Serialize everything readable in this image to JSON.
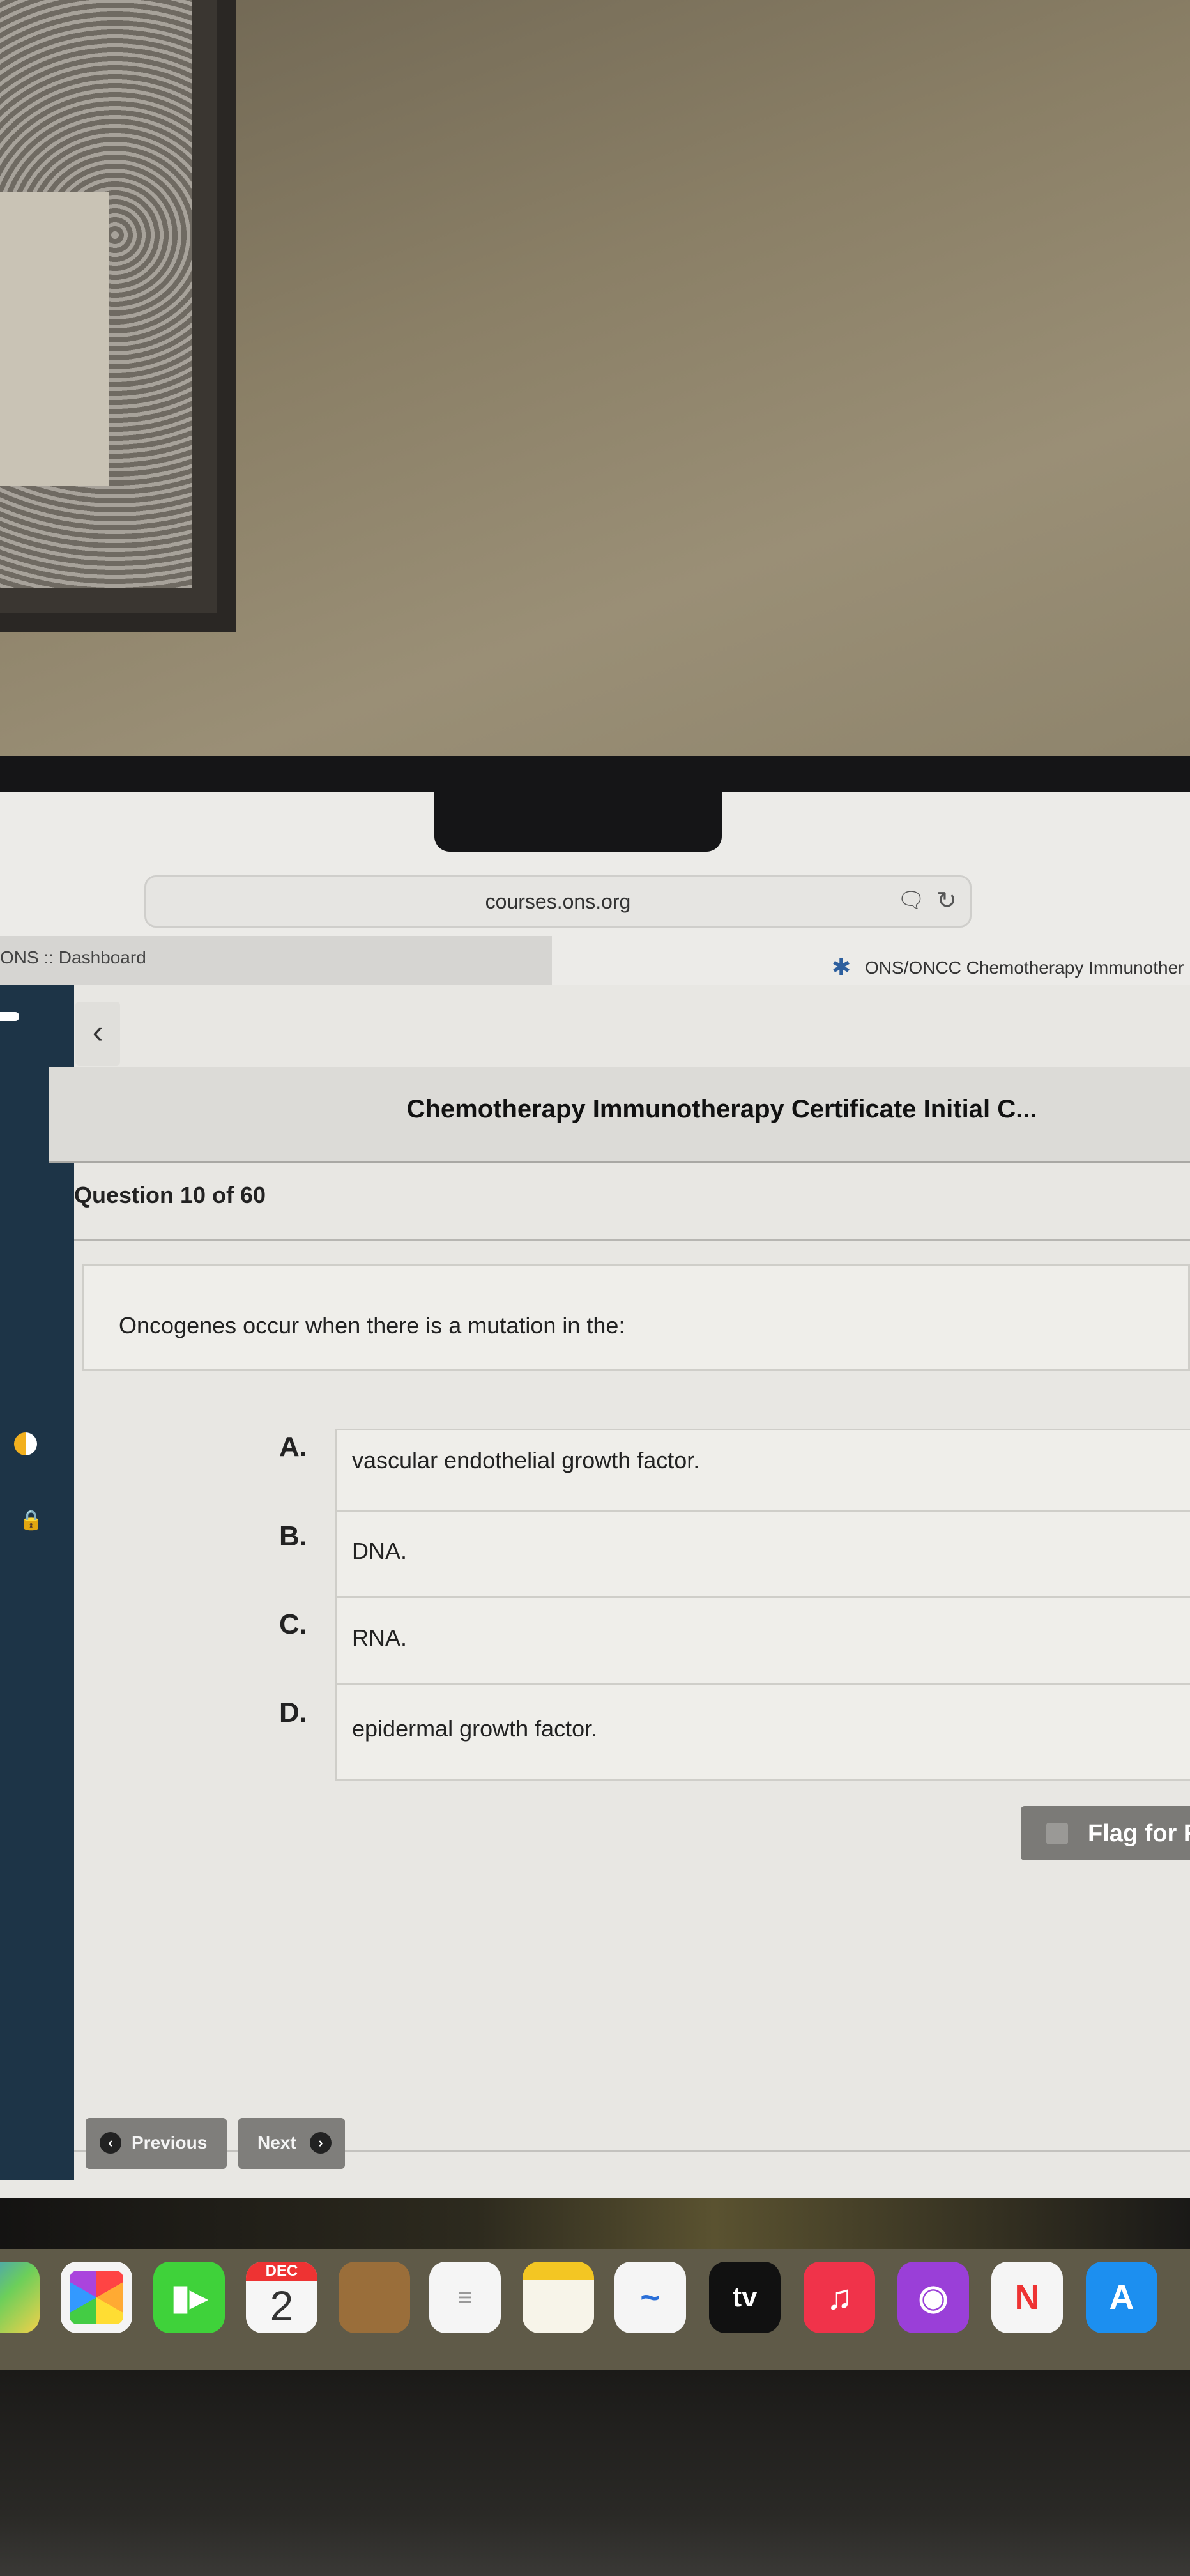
{
  "browser": {
    "url": "courses.ons.org",
    "tabs": [
      {
        "label": "ONS :: Dashboard",
        "active": false
      },
      {
        "label": "ONS/ONCC Chemotherapy Immunother",
        "active": true
      }
    ]
  },
  "course": {
    "title": "Chemotherapy Immunotherapy Certificate Initial C...",
    "question_counter": "Question 10 of 60",
    "question": "Oncogenes occur when there is a mutation in the:",
    "options": [
      {
        "letter": "A.",
        "text": "vascular endothelial growth factor."
      },
      {
        "letter": "B.",
        "text": "DNA."
      },
      {
        "letter": "C.",
        "text": "RNA."
      },
      {
        "letter": "D.",
        "text": "epidermal growth factor."
      }
    ],
    "flag_label": "Flag for R",
    "previous_label": "Previous",
    "next_label": "Next"
  },
  "dock": {
    "calendar_month": "DEC",
    "calendar_day": "2",
    "tv_label": "tv",
    "icons": [
      "maps-icon",
      "photos-icon",
      "facetime-icon",
      "calendar-icon",
      "contacts-icon",
      "reminders-icon",
      "notes-icon",
      "freeform-icon",
      "apple-tv-icon",
      "music-icon",
      "podcasts-icon",
      "news-icon",
      "app-store-icon"
    ]
  },
  "colors": {
    "sidebar": "#1d3447",
    "button_gray": "#7f7e7b",
    "progress_accent": "#f2b01e"
  }
}
